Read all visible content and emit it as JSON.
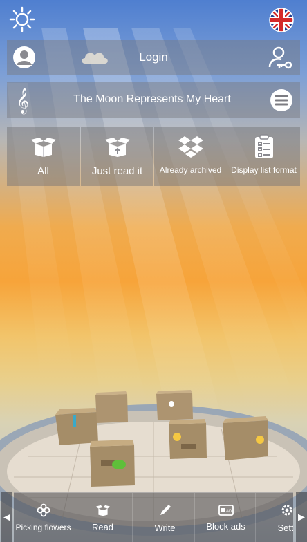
{
  "header": {
    "brightness_icon": "sun-icon",
    "language_icon": "uk-flag-icon"
  },
  "login_bar": {
    "label": "Login",
    "avatar_icon": "user-avatar-icon",
    "cloud_icon": "cloud-icon",
    "key_icon": "user-key-icon"
  },
  "song_bar": {
    "title": "The Moon Represents My Heart",
    "music_icon": "treble-clef-icon",
    "menu_icon": "menu-icon"
  },
  "filters": [
    {
      "label": "All",
      "icon": "open-box-icon"
    },
    {
      "label": "Just read it",
      "icon": "box-arrow-icon"
    },
    {
      "label": "Already archived",
      "icon": "dropbox-icon"
    },
    {
      "label": "Display list format",
      "icon": "clipboard-list-icon"
    }
  ],
  "bottom_bar": {
    "items": [
      {
        "label": "Picking flowers",
        "icon": "flower-icon"
      },
      {
        "label": "Read",
        "icon": "open-box-icon"
      },
      {
        "label": "Write",
        "icon": "pen-icon"
      },
      {
        "label": "Block ads",
        "icon": "ad-block-icon"
      },
      {
        "label": "Setti",
        "icon": "gear-icon"
      }
    ]
  },
  "colors": {
    "panel": "#78787d",
    "sky_top": "#4f7fd0",
    "sunset": "#f7a43a"
  }
}
